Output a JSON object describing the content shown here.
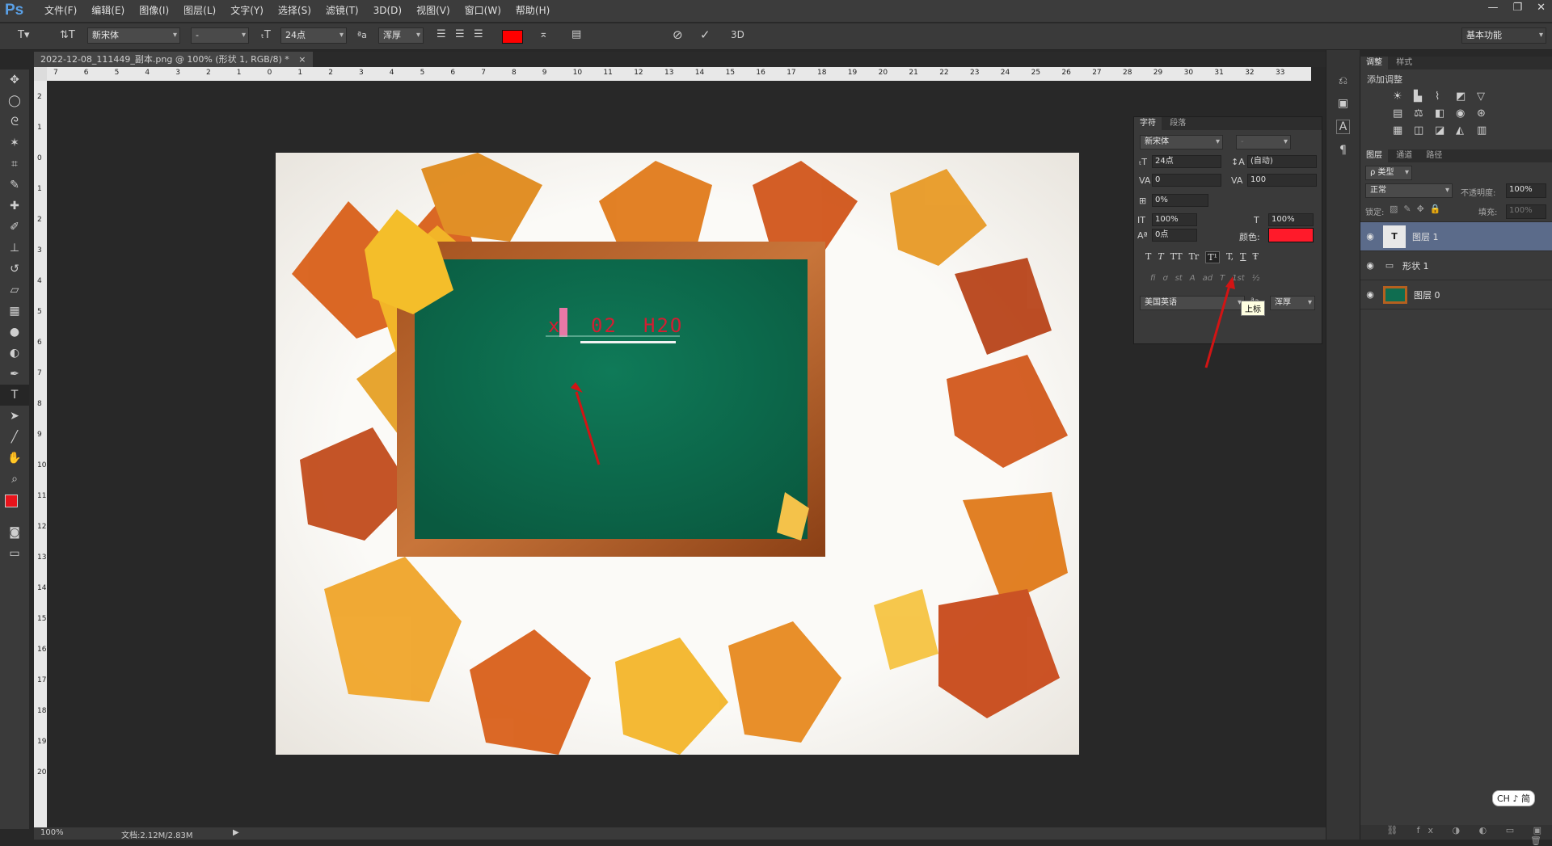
{
  "app": {
    "logo": "Ps"
  },
  "menu": [
    "文件(F)",
    "编辑(E)",
    "图像(I)",
    "图层(L)",
    "文字(Y)",
    "选择(S)",
    "滤镜(T)",
    "3D(D)",
    "视图(V)",
    "窗口(W)",
    "帮助(H)"
  ],
  "window_controls": [
    "—",
    "❐",
    "✕"
  ],
  "options": {
    "font_family": "新宋体",
    "font_style": "-",
    "font_size": "24点",
    "aa_label": "ªa",
    "antialias": "浑厚",
    "text_color": "#ff0000",
    "threed": "3D",
    "workspace": "基本功能"
  },
  "document": {
    "tab_title": "2022-12-08_111449_副本.png @ 100% (形状 1, RGB/8) *",
    "close": "×",
    "text_content": {
      "part1": "x",
      "part2": "02",
      "part3": "H2O"
    }
  },
  "ruler_h": [
    "7",
    "6",
    "5",
    "4",
    "3",
    "2",
    "1",
    "0",
    "1",
    "2",
    "3",
    "4",
    "5",
    "6",
    "7",
    "8",
    "9",
    "10",
    "11",
    "12",
    "13",
    "14",
    "15",
    "16",
    "17",
    "18",
    "19",
    "20",
    "21",
    "22",
    "23",
    "24",
    "25",
    "26",
    "27",
    "28",
    "29",
    "30",
    "31",
    "32",
    "33"
  ],
  "ruler_v": [
    "2",
    "1",
    "0",
    "1",
    "2",
    "3",
    "4",
    "5",
    "6",
    "7",
    "8",
    "9",
    "10",
    "11",
    "12",
    "13",
    "14",
    "15",
    "16",
    "17",
    "18",
    "19",
    "20"
  ],
  "status": {
    "zoom": "100%",
    "doc": "文档:2.12M/2.83M"
  },
  "char_panel": {
    "tabs": [
      "字符",
      "段落"
    ],
    "font_family": "新宋体",
    "font_style": "-",
    "size": "24点",
    "leading": "(自动)",
    "kerning": "0",
    "tracking": "100",
    "scale_pct": "0%",
    "vscale": "100%",
    "hscale": "100%",
    "baseline": "0点",
    "color_label": "颜色:",
    "color": "#ff1a2a",
    "style_buttons": [
      "T",
      "T",
      "TT",
      "Tr",
      "T¹",
      "T,",
      "T",
      "Ŧ"
    ],
    "opentype_buttons": [
      "fi",
      "ơ",
      "st",
      "A",
      "ad",
      "T",
      "1st",
      "½"
    ],
    "language": "美国英语",
    "aa_label": "ªa",
    "antialias": "浑厚",
    "tooltip": "上标"
  },
  "adjust_panel": {
    "tabs": [
      "调整",
      "样式"
    ],
    "add_label": "添加调整"
  },
  "layers_panel": {
    "tabs": [
      "图层",
      "通道",
      "路径"
    ],
    "filter": "ρ 类型",
    "blend_mode": "正常",
    "opacity_label": "不透明度:",
    "opacity": "100%",
    "lock_label": "锁定:",
    "fill_label": "填充:",
    "fill": "100%",
    "layers": [
      {
        "name": "图层 1",
        "kind": "text",
        "selected": true
      },
      {
        "name": "形状 1",
        "kind": "shape",
        "selected": false
      },
      {
        "name": "图层 0",
        "kind": "image",
        "selected": false
      }
    ]
  },
  "ime": {
    "label": "CH ♪ 简"
  }
}
